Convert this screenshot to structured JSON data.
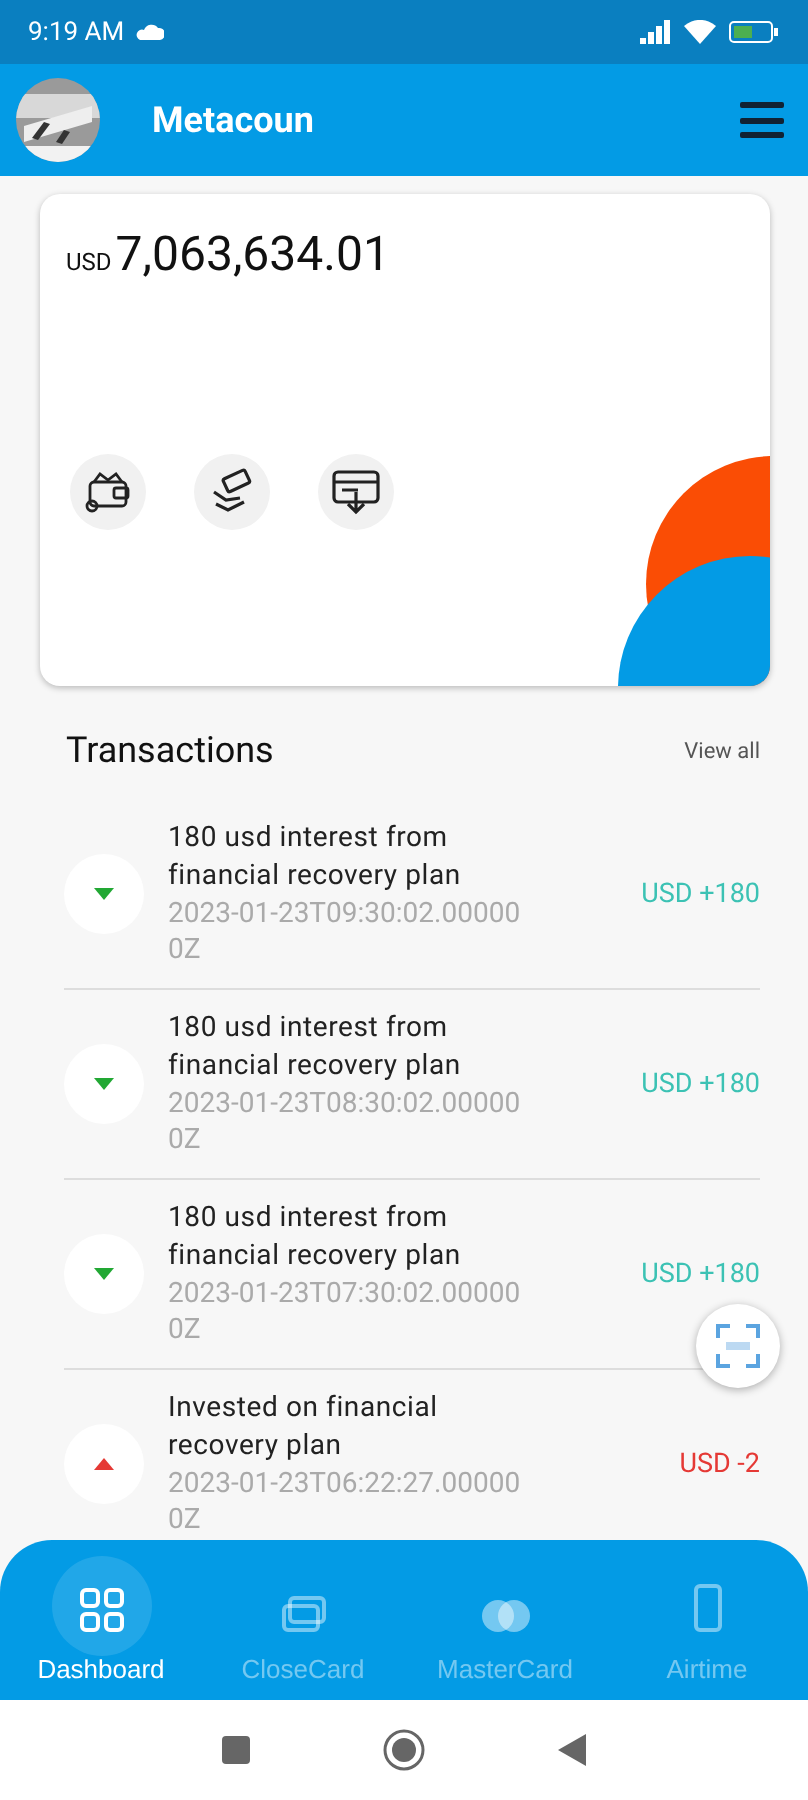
{
  "status_bar": {
    "time": "9:19 AM"
  },
  "app_bar": {
    "title": "Metacoun"
  },
  "balance": {
    "currency": "USD",
    "amount": "7,063,634.01"
  },
  "transactions": {
    "title": "Transactions",
    "view_all": "View all",
    "rows": [
      {
        "kind": "credit",
        "title": "180 usd interest from financial recovery plan",
        "time": "2023-01-23T09:30:02.000000Z",
        "amount": "USD +180"
      },
      {
        "kind": "credit",
        "title": "180 usd interest from financial recovery plan",
        "time": "2023-01-23T08:30:02.000000Z",
        "amount": "USD +180"
      },
      {
        "kind": "credit",
        "title": "180 usd interest from financial recovery plan",
        "time": "2023-01-23T07:30:02.000000Z",
        "amount": "USD +180"
      },
      {
        "kind": "debit",
        "title": "Invested on financial recovery plan",
        "time": "2023-01-23T06:22:27.000000Z",
        "amount": "USD -2"
      }
    ]
  },
  "bottom_nav": [
    {
      "kind": "dashboard",
      "label": "Dashboard",
      "selected": true
    },
    {
      "kind": "card",
      "label": "CloseCard",
      "selected": false
    },
    {
      "kind": "mastercard",
      "label": "MasterCard",
      "selected": false
    },
    {
      "kind": "phone",
      "label": "Airtime",
      "selected": false
    }
  ]
}
